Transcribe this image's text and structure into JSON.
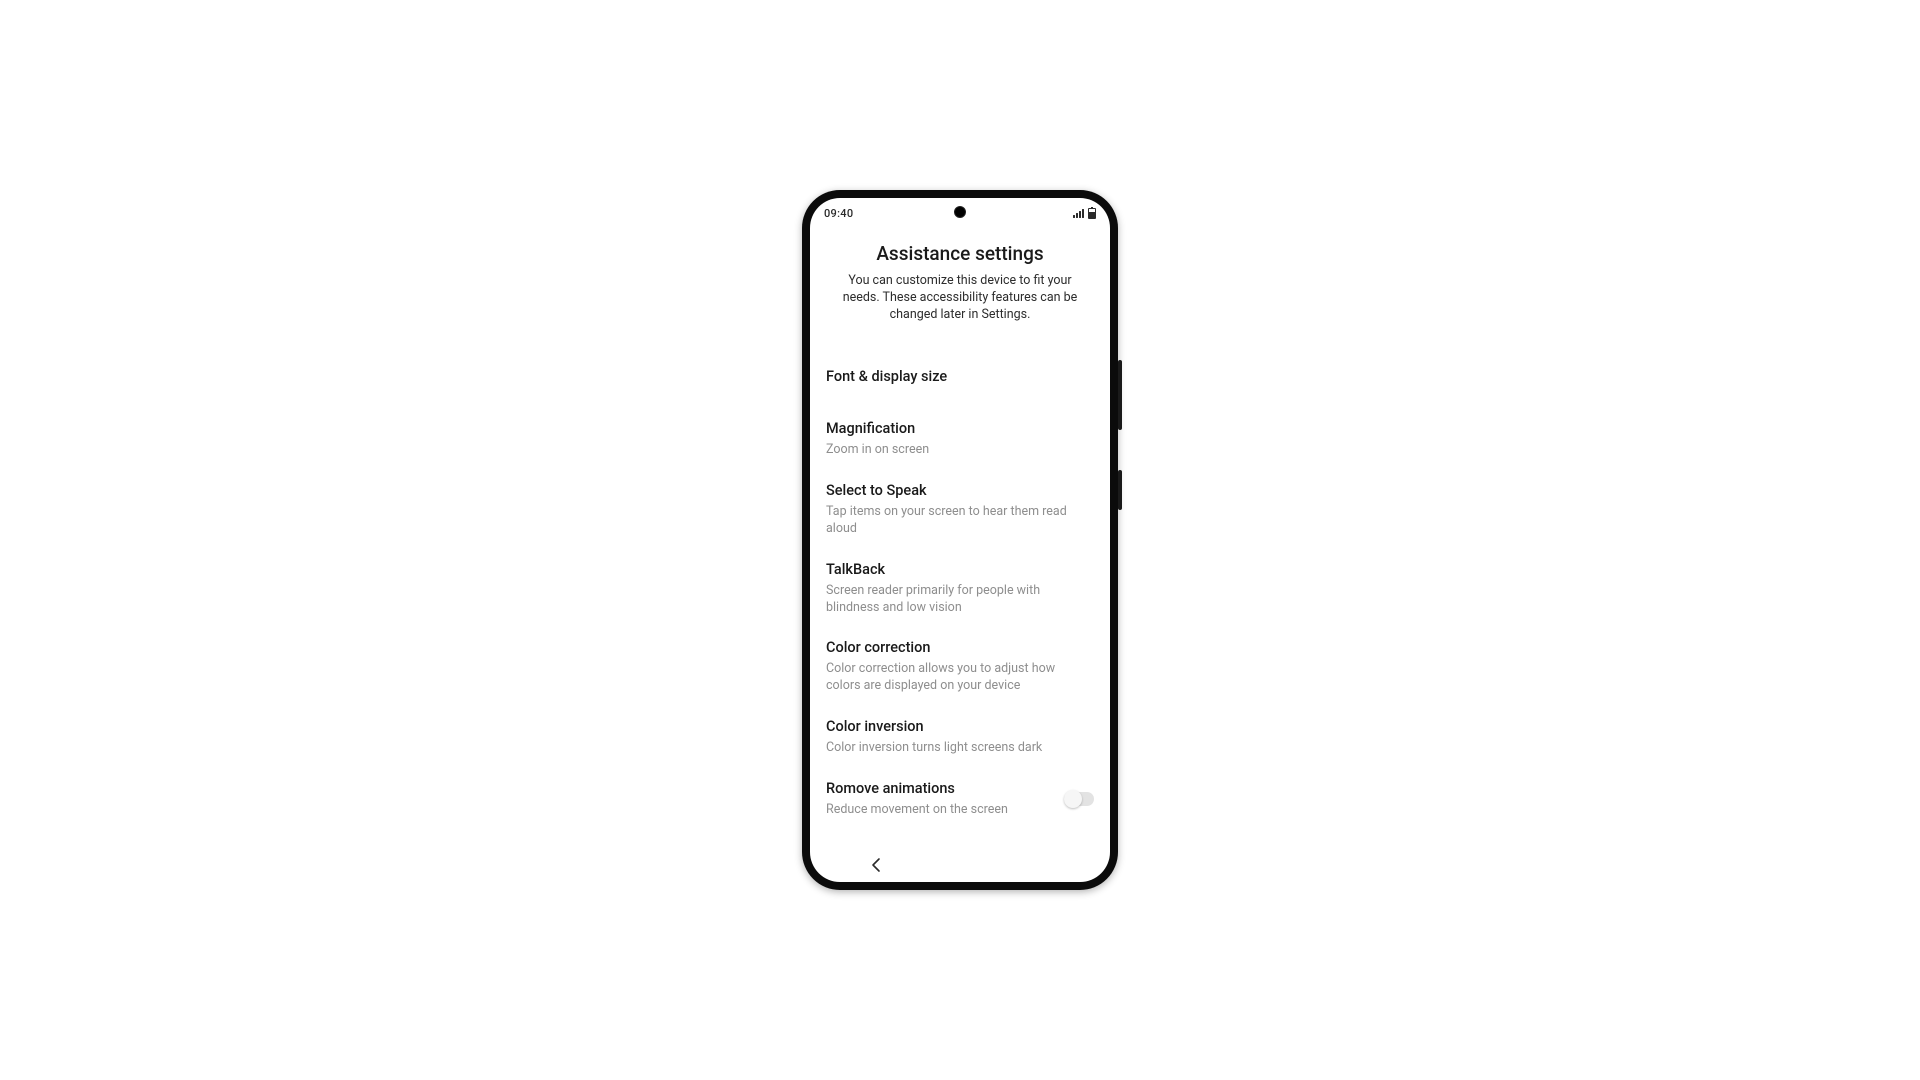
{
  "status_bar": {
    "time": "09:40"
  },
  "header": {
    "title": "Assistance settings",
    "subtitle": "You can customize this device to fit your needs. These accessibility features can be changed later in Settings."
  },
  "items": [
    {
      "title": "Font & display size",
      "desc": ""
    },
    {
      "title": "Magnification",
      "desc": "Zoom in on screen"
    },
    {
      "title": "Select to Speak",
      "desc": "Tap items on your screen to hear them read aloud"
    },
    {
      "title": "TalkBack",
      "desc": "Screen reader primarily for people with blindness and low vision"
    },
    {
      "title": "Color correction",
      "desc": "Color correction allows you to adjust how colors are displayed on your device"
    },
    {
      "title": "Color inversion",
      "desc": "Color inversion turns light screens dark"
    },
    {
      "title": "Romove animations",
      "desc": "Reduce movement on the screen",
      "toggle": false
    }
  ]
}
